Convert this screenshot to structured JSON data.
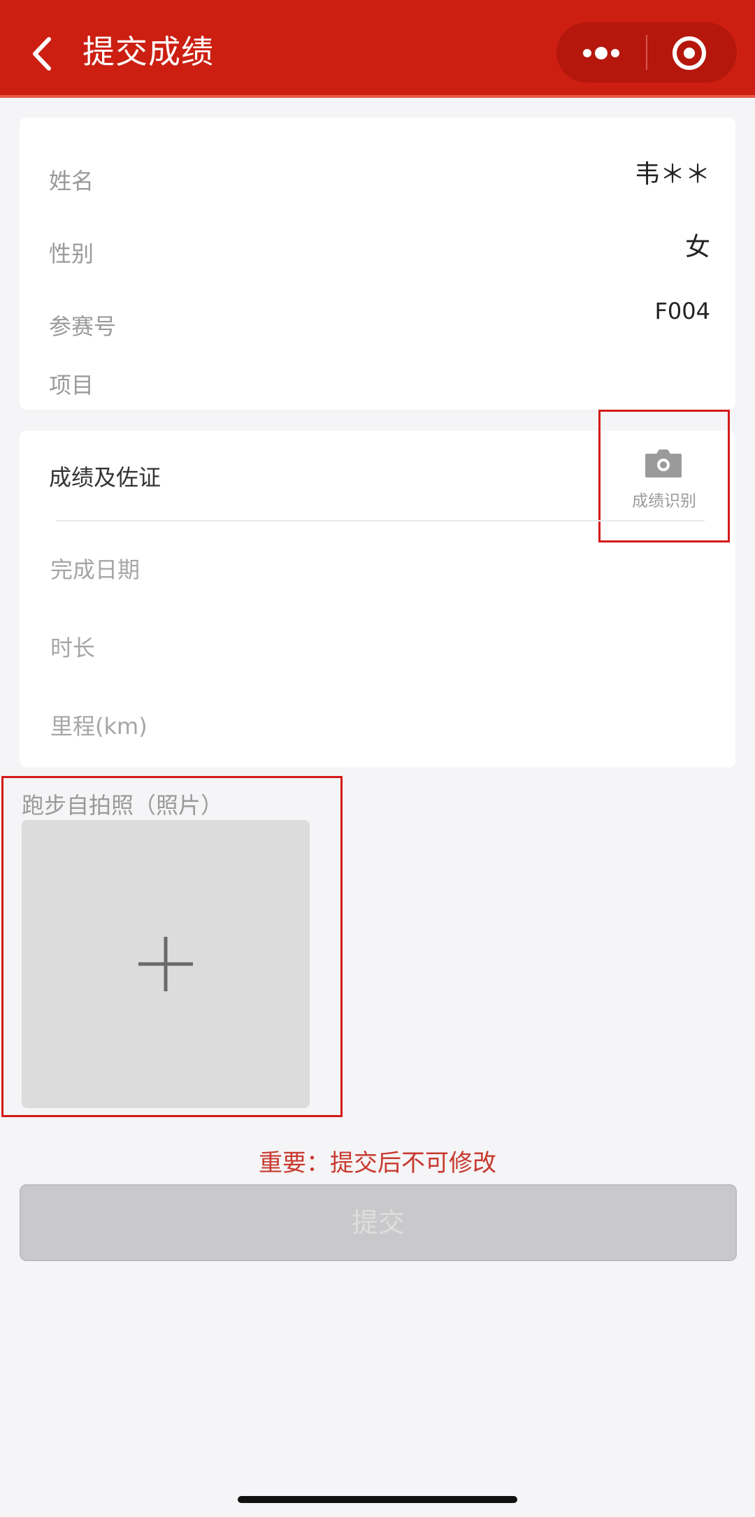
{
  "header": {
    "title": "提交成绩",
    "back_icon": "chevron-left-icon",
    "more_icon": "more-dots-icon",
    "close_icon": "target-circle-icon",
    "color": "#cc1f12"
  },
  "info": {
    "rows": [
      {
        "label": "姓名",
        "value": "韦＊＊"
      },
      {
        "label": "性别",
        "value": "女"
      },
      {
        "label": "参赛号",
        "value": "F004"
      },
      {
        "label": "项目",
        "value": ""
      }
    ]
  },
  "result": {
    "title": "成绩及佐证",
    "ocr_label": "成绩识别",
    "ocr_icon": "camera-icon",
    "fields": [
      {
        "label": "完成日期"
      },
      {
        "label": "时长"
      },
      {
        "label": "里程(km)"
      }
    ]
  },
  "photo": {
    "label": "跑步自拍照（照片）",
    "add_icon": "plus-icon"
  },
  "footer": {
    "warning": "重要：提交后不可修改",
    "warning_color": "#c8392e",
    "submit_label": "提交"
  }
}
